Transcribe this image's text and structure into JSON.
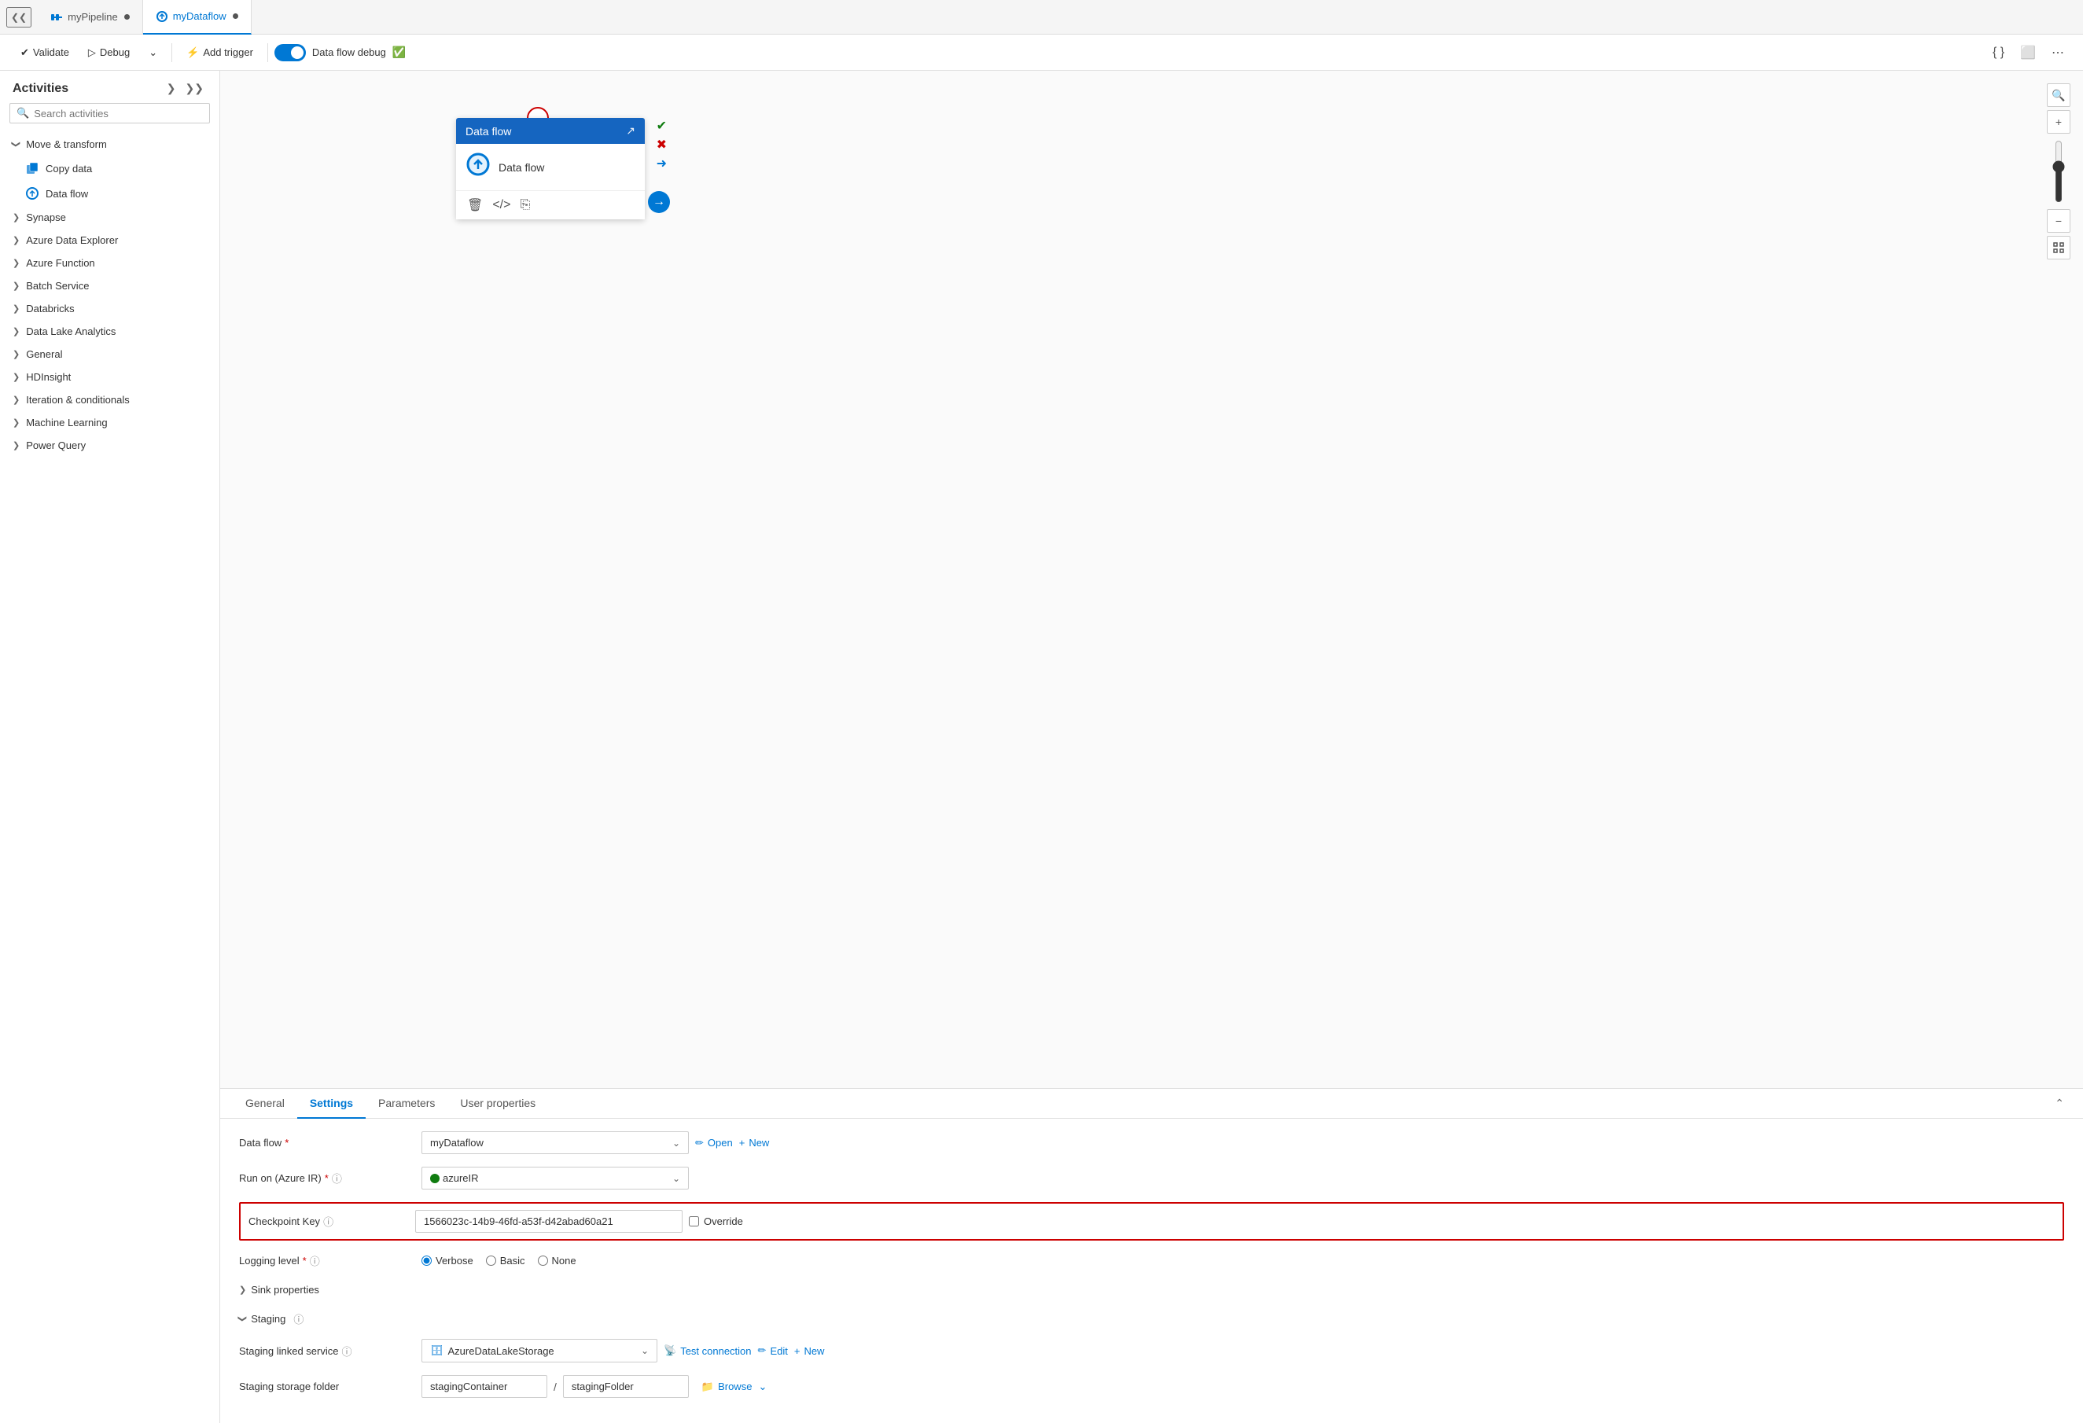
{
  "tabs": [
    {
      "id": "pipeline",
      "label": "myPipeline",
      "icon": "pipeline",
      "active": false,
      "dot": true
    },
    {
      "id": "dataflow",
      "label": "myDataflow",
      "icon": "dataflow",
      "active": true,
      "dot": true
    }
  ],
  "toolbar": {
    "validate_label": "Validate",
    "debug_label": "Debug",
    "add_trigger_label": "Add trigger",
    "dataflow_debug_label": "Data flow debug",
    "dataflow_debug_active": true
  },
  "sidebar": {
    "title": "Activities",
    "search_placeholder": "Search activities",
    "sections": [
      {
        "id": "move-transform",
        "label": "Move & transform",
        "expanded": true,
        "items": [
          {
            "label": "Copy data",
            "icon": "copy"
          },
          {
            "label": "Data flow",
            "icon": "dataflow"
          }
        ]
      },
      {
        "id": "synapse",
        "label": "Synapse",
        "expanded": false,
        "items": []
      },
      {
        "id": "azure-data-explorer",
        "label": "Azure Data Explorer",
        "expanded": false,
        "items": []
      },
      {
        "id": "azure-function",
        "label": "Azure Function",
        "expanded": false,
        "items": []
      },
      {
        "id": "batch-service",
        "label": "Batch Service",
        "expanded": false,
        "items": []
      },
      {
        "id": "databricks",
        "label": "Databricks",
        "expanded": false,
        "items": []
      },
      {
        "id": "data-lake-analytics",
        "label": "Data Lake Analytics",
        "expanded": false,
        "items": []
      },
      {
        "id": "general",
        "label": "General",
        "expanded": false,
        "items": []
      },
      {
        "id": "hdinsight",
        "label": "HDInsight",
        "expanded": false,
        "items": []
      },
      {
        "id": "iteration-conditionals",
        "label": "Iteration & conditionals",
        "expanded": false,
        "items": []
      },
      {
        "id": "machine-learning",
        "label": "Machine Learning",
        "expanded": false,
        "items": []
      },
      {
        "id": "power-query",
        "label": "Power Query",
        "expanded": false,
        "items": []
      }
    ]
  },
  "canvas": {
    "node": {
      "title": "Data flow",
      "body_label": "Data flow"
    }
  },
  "settings": {
    "tabs": [
      {
        "id": "general",
        "label": "General",
        "active": false
      },
      {
        "id": "settings",
        "label": "Settings",
        "active": true
      },
      {
        "id": "parameters",
        "label": "Parameters",
        "active": false
      },
      {
        "id": "user-properties",
        "label": "User properties",
        "active": false
      }
    ],
    "fields": {
      "data_flow_label": "Data flow",
      "data_flow_required": "*",
      "data_flow_value": "myDataflow",
      "data_flow_open": "Open",
      "data_flow_new": "New",
      "run_on_label": "Run on (Azure IR)",
      "run_on_required": "*",
      "run_on_value": "azureIR",
      "run_on_status": "green",
      "checkpoint_key_label": "Checkpoint Key",
      "checkpoint_key_value": "1566023c-14b9-46fd-a53f-d42abad60a21",
      "checkpoint_override_label": "Override",
      "logging_level_label": "Logging level",
      "logging_level_required": "*",
      "logging_levels": [
        "Verbose",
        "Basic",
        "None"
      ],
      "logging_level_selected": "Verbose",
      "sink_properties_label": "Sink properties",
      "staging_label": "Staging",
      "staging_linked_service_label": "Staging linked service",
      "staging_linked_service_value": "AzureDataLakeStorage",
      "staging_linked_service_test": "Test connection",
      "staging_linked_service_edit": "Edit",
      "staging_linked_service_new": "New",
      "staging_storage_folder_label": "Staging storage folder",
      "staging_container_value": "stagingContainer",
      "staging_folder_value": "stagingFolder",
      "staging_browse": "Browse"
    }
  }
}
